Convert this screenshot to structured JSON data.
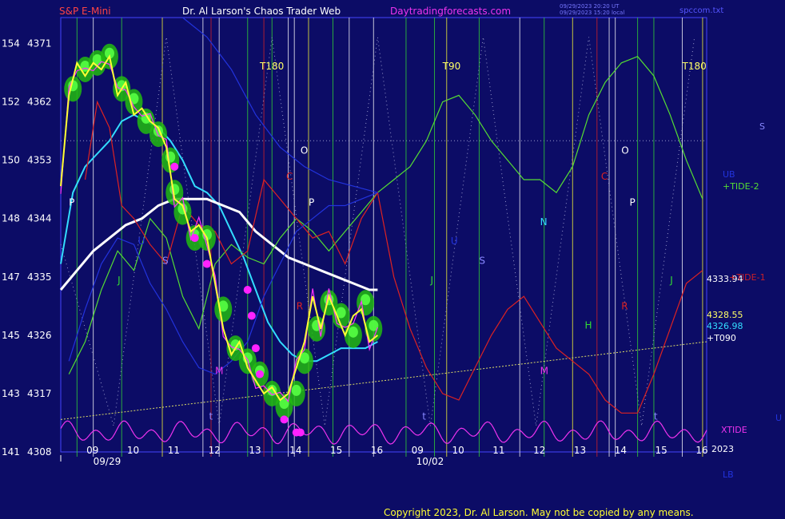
{
  "header": {
    "symbol": "S&P E-Mini",
    "site": "Dr. Al Larson's Chaos Trader Web",
    "url": "Daytradingforecasts.com",
    "timestamp1": "09/29/2023 20:20 UT",
    "timestamp2": "09/29/2023 15:20 local",
    "filename": "spccom.txt",
    "copyright": "Copyright 2023, Dr. Al Larson. May not be copied by any means."
  },
  "colors": {
    "background": "#0c0c66",
    "price": "#ffff33",
    "price_fast": "#ff33ff",
    "glow": "#33ee22",
    "cyan_ma": "#33ddff",
    "white_ma": "#ffffff",
    "tide_green": "#55dd33",
    "tide_red": "#dd2222",
    "xtide": "#ee33ee",
    "blue_band": "#2233dd",
    "trend": "#dddd66"
  },
  "chart_data": {
    "type": "line",
    "ylim": [
      4308,
      4375
    ],
    "y_ticks": [
      {
        "left": "154",
        "price": 4371
      },
      {
        "left": "152",
        "price": 4362
      },
      {
        "left": "150",
        "price": 4353
      },
      {
        "left": "148",
        "price": 4344
      },
      {
        "left": "147",
        "price": 4335
      },
      {
        "left": "145",
        "price": 4326
      },
      {
        "left": "143",
        "price": 4317
      },
      {
        "left": "141",
        "price": 4308
      }
    ],
    "x_hours": [
      {
        "label": "09",
        "x": 0.75
      },
      {
        "label": "10",
        "x": 1.75
      },
      {
        "label": "11",
        "x": 2.75
      },
      {
        "label": "12",
        "x": 3.75
      },
      {
        "label": "13",
        "x": 4.75
      },
      {
        "label": "14",
        "x": 5.75
      },
      {
        "label": "15",
        "x": 6.75
      },
      {
        "label": "16",
        "x": 7.75
      },
      {
        "label": "09",
        "x": 8.75
      },
      {
        "label": "10",
        "x": 9.75
      },
      {
        "label": "11",
        "x": 10.75
      },
      {
        "label": "12",
        "x": 11.75
      },
      {
        "label": "13",
        "x": 12.75
      },
      {
        "label": "14",
        "x": 13.75
      },
      {
        "label": "15",
        "x": 14.75
      },
      {
        "label": "16",
        "x": 15.75
      }
    ],
    "x_dates": [
      {
        "label": "09/29",
        "x": 0.8
      },
      {
        "label": "10/02",
        "x": 8.75
      }
    ],
    "xlim": [
      0,
      15.9
    ],
    "series": [
      {
        "key": "price",
        "color": "#ffff33",
        "x": [
          0,
          0.2,
          0.4,
          0.6,
          0.8,
          1.0,
          1.2,
          1.4,
          1.6,
          1.8,
          2.0,
          2.2,
          2.4,
          2.6,
          2.8,
          3.0,
          3.2,
          3.4,
          3.6,
          3.8,
          4.0,
          4.2,
          4.4,
          4.6,
          4.8,
          5.0,
          5.2,
          5.4,
          5.6,
          5.8,
          6.0,
          6.2,
          6.4,
          6.6,
          6.8,
          7.0,
          7.2,
          7.4,
          7.6,
          7.8
        ],
        "y": [
          4349,
          4363,
          4368,
          4366,
          4368,
          4367,
          4369,
          4363,
          4365,
          4360,
          4361,
          4359,
          4358,
          4355,
          4347,
          4346,
          4342,
          4343,
          4341,
          4334,
          4327,
          4323,
          4325,
          4321,
          4319,
          4317,
          4318,
          4316,
          4317,
          4321,
          4325,
          4332,
          4327,
          4332,
          4329,
          4326,
          4329,
          4330,
          4325,
          4326
        ]
      },
      {
        "key": "cyan_ma",
        "color": "#33ddff",
        "x": [
          0,
          0.3,
          0.6,
          0.9,
          1.2,
          1.5,
          1.8,
          2.1,
          2.4,
          2.7,
          3.0,
          3.3,
          3.6,
          3.9,
          4.2,
          4.5,
          4.8,
          5.1,
          5.4,
          5.7,
          6.0,
          6.3,
          6.6,
          6.9,
          7.2,
          7.5,
          7.8
        ],
        "y": [
          4337,
          4348,
          4352,
          4354,
          4356,
          4359,
          4360,
          4359,
          4358,
          4356,
          4353,
          4349,
          4348,
          4346,
          4342,
          4338,
          4333,
          4328,
          4325,
          4323,
          4322,
          4322,
          4323,
          4324,
          4324,
          4324,
          4325
        ]
      },
      {
        "key": "white_ma",
        "color": "#ffffff",
        "x": [
          0,
          0.4,
          0.8,
          1.2,
          1.6,
          2.0,
          2.4,
          2.8,
          3.2,
          3.6,
          4.0,
          4.4,
          4.8,
          5.2,
          5.6,
          6.0,
          6.4,
          6.8,
          7.2,
          7.6,
          7.8
        ],
        "y": [
          4333,
          4336,
          4339,
          4341,
          4343,
          4344,
          4346,
          4347,
          4347,
          4347,
          4346,
          4345,
          4342,
          4340,
          4338,
          4337,
          4336,
          4335,
          4334,
          4333,
          4333
        ]
      },
      {
        "key": "tide_green",
        "color": "#55dd33",
        "x": [
          0.2,
          0.6,
          1.0,
          1.4,
          1.8,
          2.2,
          2.6,
          3.0,
          3.4,
          3.8,
          4.2,
          4.6,
          5.0,
          5.4,
          5.8,
          6.2,
          6.6,
          7.0,
          7.4,
          7.8,
          8.2,
          8.6,
          9.0,
          9.4,
          9.8,
          10.2,
          10.6,
          11.0,
          11.4,
          11.8,
          12.2,
          12.6,
          13.0,
          13.4,
          13.8,
          14.2,
          14.6,
          15.0,
          15.4,
          15.8
        ],
        "y": [
          4320,
          4325,
          4333,
          4339,
          4336,
          4344,
          4341,
          4332,
          4327,
          4337,
          4340,
          4338,
          4337,
          4341,
          4344,
          4342,
          4339,
          4342,
          4345,
          4348,
          4350,
          4352,
          4356,
          4362,
          4363,
          4360,
          4356,
          4353,
          4350,
          4350,
          4348,
          4352,
          4360,
          4365,
          4368,
          4369,
          4366,
          4360,
          4353,
          4347
        ]
      },
      {
        "key": "tide_red",
        "color": "#dd2222",
        "x": [
          0.6,
          0.9,
          1.2,
          1.5,
          1.8,
          2.2,
          2.6,
          3.0,
          3.4,
          3.8,
          4.2,
          4.6,
          5.0,
          5.4,
          5.8,
          6.2,
          6.6,
          7.0,
          7.4,
          7.8,
          8.2,
          8.6,
          9.0,
          9.4,
          9.8,
          10.2,
          10.6,
          11.0,
          11.4,
          11.8,
          12.2,
          12.6,
          13.0,
          13.4,
          13.8,
          14.2,
          14.6,
          15.0,
          15.4,
          15.8
        ],
        "y": [
          4350,
          4362,
          4358,
          4346,
          4344,
          4340,
          4337,
          4346,
          4343,
          4342,
          4337,
          4339,
          4350,
          4347,
          4344,
          4341,
          4342,
          4337,
          4344,
          4348,
          4335,
          4327,
          4321,
          4317,
          4316,
          4321,
          4326,
          4330,
          4332,
          4328,
          4324,
          4322,
          4320,
          4316,
          4314,
          4314,
          4320,
          4327,
          4334,
          4336
        ]
      },
      {
        "key": "blue_band",
        "color": "#2233dd",
        "x": [
          0.2,
          0.6,
          1.0,
          1.4,
          1.8,
          2.2,
          2.6,
          3.0,
          3.4,
          3.8,
          4.2,
          4.6,
          5.0,
          5.4,
          5.8,
          6.2,
          6.6,
          7.0,
          7.4,
          7.8
        ],
        "y": [
          4322,
          4330,
          4337,
          4341,
          4340,
          4334,
          4330,
          4325,
          4321,
          4320,
          4322,
          4325,
          4332,
          4337,
          4342,
          4344,
          4346,
          4346,
          4347,
          4348
        ]
      },
      {
        "key": "upper_blue",
        "color": "#2233dd",
        "x": [
          3.0,
          3.6,
          4.2,
          4.8,
          5.4,
          6.0,
          6.6,
          7.2,
          7.8
        ],
        "y": [
          4375,
          4372,
          4367,
          4360,
          4355,
          4352,
          4350,
          4349,
          4348
        ]
      }
    ],
    "trend_line": {
      "x": [
        0,
        15.9
      ],
      "y": [
        4313,
        4325
      ]
    },
    "dotted_level": 4356,
    "glow_points": {
      "x": [
        0.3,
        0.6,
        0.9,
        1.2,
        1.5,
        1.8,
        2.1,
        2.4,
        2.7,
        2.8,
        3.0,
        3.3,
        3.6,
        4.0,
        4.3,
        4.6,
        4.9,
        5.2,
        5.5,
        5.8,
        6.0,
        6.3,
        6.6,
        6.9,
        7.2,
        7.5,
        7.7
      ],
      "y": [
        4364,
        4367,
        4368,
        4369,
        4364,
        4362,
        4359,
        4357,
        4353,
        4348,
        4345,
        4341,
        4341,
        4330,
        4324,
        4322,
        4320,
        4317,
        4315,
        4317,
        4322,
        4327,
        4331,
        4329,
        4326,
        4331,
        4327
      ]
    },
    "magenta_points": {
      "x": [
        2.8,
        3.3,
        3.6,
        4.6,
        4.7,
        4.8,
        4.9,
        5.5,
        5.8,
        5.9
      ],
      "y": [
        4352,
        4341,
        4337,
        4333,
        4329,
        4324,
        4320,
        4313,
        4311,
        4311
      ]
    },
    "xtide": {
      "name": "XTIDE",
      "base": 4311,
      "amp": 1.8
    },
    "vlines": [
      {
        "x": 0.4,
        "color": "#33dd33"
      },
      {
        "x": 0.8,
        "color": "#ffffff"
      },
      {
        "x": 1.5,
        "color": "#33dd33"
      },
      {
        "x": 2.5,
        "color": "#ffff33"
      },
      {
        "x": 3.5,
        "color": "#ffffff"
      },
      {
        "x": 3.7,
        "color": "#dd2222"
      },
      {
        "x": 3.9,
        "color": "#ffffff"
      },
      {
        "x": 4.6,
        "color": "#33dd33"
      },
      {
        "x": 5.0,
        "color": "#dd2222"
      },
      {
        "x": 5.2,
        "color": "#33dd33"
      },
      {
        "x": 5.6,
        "color": "#ffffff"
      },
      {
        "x": 5.75,
        "color": "#ffffff"
      },
      {
        "x": 6.1,
        "color": "#ffff33"
      },
      {
        "x": 6.7,
        "color": "#33dd33"
      },
      {
        "x": 7.1,
        "color": "#ffffff"
      },
      {
        "x": 7.7,
        "color": "#ffffff"
      },
      {
        "x": 8.5,
        "color": "#33dd33"
      },
      {
        "x": 9.2,
        "color": "#33dd33"
      },
      {
        "x": 9.5,
        "color": "#ffff33"
      },
      {
        "x": 10.3,
        "color": "#33dd33"
      },
      {
        "x": 11.3,
        "color": "#ffffff"
      },
      {
        "x": 11.9,
        "color": "#33dd33"
      },
      {
        "x": 12.6,
        "color": "#ffff33"
      },
      {
        "x": 13.2,
        "color": "#dd2222"
      },
      {
        "x": 13.5,
        "color": "#ffffff"
      },
      {
        "x": 13.65,
        "color": "#ffffff"
      },
      {
        "x": 14.2,
        "color": "#33dd33"
      },
      {
        "x": 14.6,
        "color": "#33dd33"
      },
      {
        "x": 15.3,
        "color": "#ffffff"
      },
      {
        "x": 15.8,
        "color": "#ffff33"
      }
    ],
    "zigzag": {
      "x": [
        0,
        1.3,
        2.6,
        3.9,
        5.2,
        6.5,
        7.8,
        9.1,
        10.4,
        11.7,
        13.0,
        14.3,
        15.6
      ],
      "y": [
        4340,
        4312,
        4372,
        4312,
        4372,
        4312,
        4372,
        4312,
        4372,
        4312,
        4372,
        4312,
        4372
      ]
    },
    "annotations": [
      {
        "t": "T180",
        "x": 4.9,
        "y": 4367,
        "c": "#ffff66"
      },
      {
        "t": "T90",
        "x": 9.4,
        "y": 4367,
        "c": "#ffff66"
      },
      {
        "t": "T180",
        "x": 15.3,
        "y": 4367,
        "c": "#ffff66"
      },
      {
        "t": "P",
        "x": 0.2,
        "y": 4346,
        "c": "#ffffff"
      },
      {
        "t": "O",
        "x": 5.9,
        "y": 4354,
        "c": "#ffffff"
      },
      {
        "t": "O",
        "x": 13.8,
        "y": 4354,
        "c": "#ffffff"
      },
      {
        "t": "P",
        "x": 6.1,
        "y": 4346,
        "c": "#ffffff"
      },
      {
        "t": "P",
        "x": 14.0,
        "y": 4346,
        "c": "#ffffff"
      },
      {
        "t": "C",
        "x": 5.55,
        "y": 4350,
        "c": "#dd2222"
      },
      {
        "t": "C",
        "x": 13.3,
        "y": 4350,
        "c": "#dd2222"
      },
      {
        "t": "U",
        "x": 1.9,
        "y": 4340,
        "c": "#2233dd"
      },
      {
        "t": "U",
        "x": 9.6,
        "y": 4340,
        "c": "#2233dd"
      },
      {
        "t": "S",
        "x": 2.5,
        "y": 4337,
        "c": "#8888ff"
      },
      {
        "t": "S",
        "x": 10.3,
        "y": 4337,
        "c": "#8888ff"
      },
      {
        "t": "J",
        "x": 1.4,
        "y": 4334,
        "c": "#33dd33"
      },
      {
        "t": "J",
        "x": 9.1,
        "y": 4334,
        "c": "#33dd33"
      },
      {
        "t": "J",
        "x": 15.0,
        "y": 4334,
        "c": "#33dd33"
      },
      {
        "t": "N",
        "x": 11.8,
        "y": 4343,
        "c": "#33ddff"
      },
      {
        "t": "H",
        "x": 12.9,
        "y": 4327,
        "c": "#33dd33"
      },
      {
        "t": "M",
        "x": 3.8,
        "y": 4320,
        "c": "#ee33ee"
      },
      {
        "t": "M",
        "x": 11.8,
        "y": 4320,
        "c": "#ee33ee"
      },
      {
        "t": "R",
        "x": 5.8,
        "y": 4330,
        "c": "#dd2222"
      },
      {
        "t": "R",
        "x": 13.8,
        "y": 4330,
        "c": "#dd2222"
      },
      {
        "t": "t",
        "x": 3.65,
        "y": 4313,
        "c": "#8888ff"
      },
      {
        "t": "t",
        "x": 8.9,
        "y": 4313,
        "c": "#8888ff"
      },
      {
        "t": "t",
        "x": 14.6,
        "y": 4313,
        "c": "#8888ff"
      }
    ]
  },
  "right_labels": [
    {
      "text": "S",
      "color": "#8888ff"
    },
    {
      "text": "UB",
      "color": "#2233dd"
    },
    {
      "text": "+TIDE-2",
      "color": "#55dd33"
    },
    {
      "text": "4333.94",
      "color": "#ffffff"
    },
    {
      "text": "+TIDE-1",
      "color": "#dd2222"
    },
    {
      "text": "4328.55",
      "color": "#ffff66"
    },
    {
      "text": "4326.98",
      "color": "#33ddff"
    },
    {
      "text": "+T090",
      "color": "#ffffff"
    },
    {
      "text": "XTIDE",
      "color": "#ee33ee"
    },
    {
      "text": "U",
      "color": "#2233dd"
    },
    {
      "text": "2023",
      "color": "#ffffff"
    },
    {
      "text": "LB",
      "color": "#2233dd"
    }
  ]
}
